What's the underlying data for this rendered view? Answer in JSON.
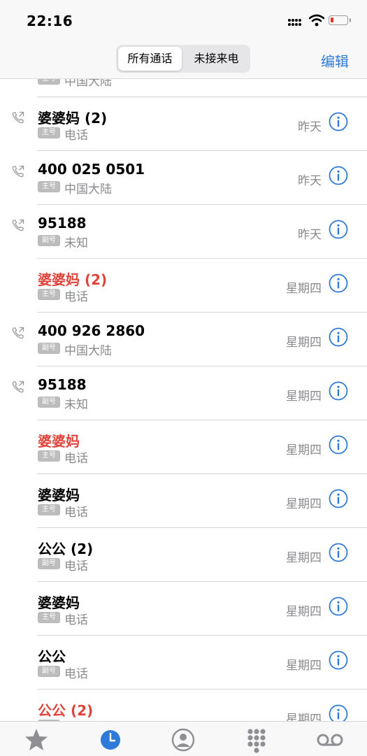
{
  "status_bar": {
    "time": "22:16",
    "battery_level": 0.2
  },
  "nav": {
    "segments": [
      "所有通话",
      "未接来电"
    ],
    "selected_segment": "所有通话",
    "edit_label": "编辑"
  },
  "top_partial_row": {
    "badge": "主号",
    "subtitle": "中国大陆"
  },
  "calls": [
    {
      "name": "婆婆妈 (2)",
      "badge": "主号",
      "subtitle": "电话",
      "date": "昨天",
      "missed": false,
      "outgoing": true
    },
    {
      "name": "400 025 0501",
      "badge": "主号",
      "subtitle": "中国大陆",
      "date": "昨天",
      "missed": false,
      "outgoing": true
    },
    {
      "name": "95188",
      "badge": "副号",
      "subtitle": "未知",
      "date": "昨天",
      "missed": false,
      "outgoing": true
    },
    {
      "name": "婆婆妈 (2)",
      "badge": "主号",
      "subtitle": "电话",
      "date": "星期四",
      "missed": true,
      "outgoing": false
    },
    {
      "name": "400 926 2860",
      "badge": "副号",
      "subtitle": "中国大陆",
      "date": "星期四",
      "missed": false,
      "outgoing": true
    },
    {
      "name": "95188",
      "badge": "副号",
      "subtitle": "未知",
      "date": "星期四",
      "missed": false,
      "outgoing": true
    },
    {
      "name": "婆婆妈",
      "badge": "主号",
      "subtitle": "电话",
      "date": "星期四",
      "missed": true,
      "outgoing": false
    },
    {
      "name": "婆婆妈",
      "badge": "主号",
      "subtitle": "电话",
      "date": "星期四",
      "missed": false,
      "outgoing": false
    },
    {
      "name": "公公 (2)",
      "badge": "副号",
      "subtitle": "电话",
      "date": "星期四",
      "missed": false,
      "outgoing": false
    },
    {
      "name": "婆婆妈",
      "badge": "主号",
      "subtitle": "电话",
      "date": "星期四",
      "missed": false,
      "outgoing": false
    },
    {
      "name": "公公",
      "badge": "副号",
      "subtitle": "电话",
      "date": "星期四",
      "missed": false,
      "outgoing": false
    },
    {
      "name": "公公 (2)",
      "badge": "",
      "subtitle": "",
      "date": "星期四",
      "missed": true,
      "outgoing": false
    }
  ],
  "tabs": [
    {
      "icon": "star-icon",
      "selected": false
    },
    {
      "icon": "clock-icon",
      "selected": true
    },
    {
      "icon": "person-circle-icon",
      "selected": false
    },
    {
      "icon": "keypad-icon",
      "selected": false
    },
    {
      "icon": "voicemail-icon",
      "selected": false
    }
  ],
  "colors": {
    "accent": "#2f7ad8",
    "missed": "#e0443a",
    "secondary_text": "#8a8a8e"
  }
}
